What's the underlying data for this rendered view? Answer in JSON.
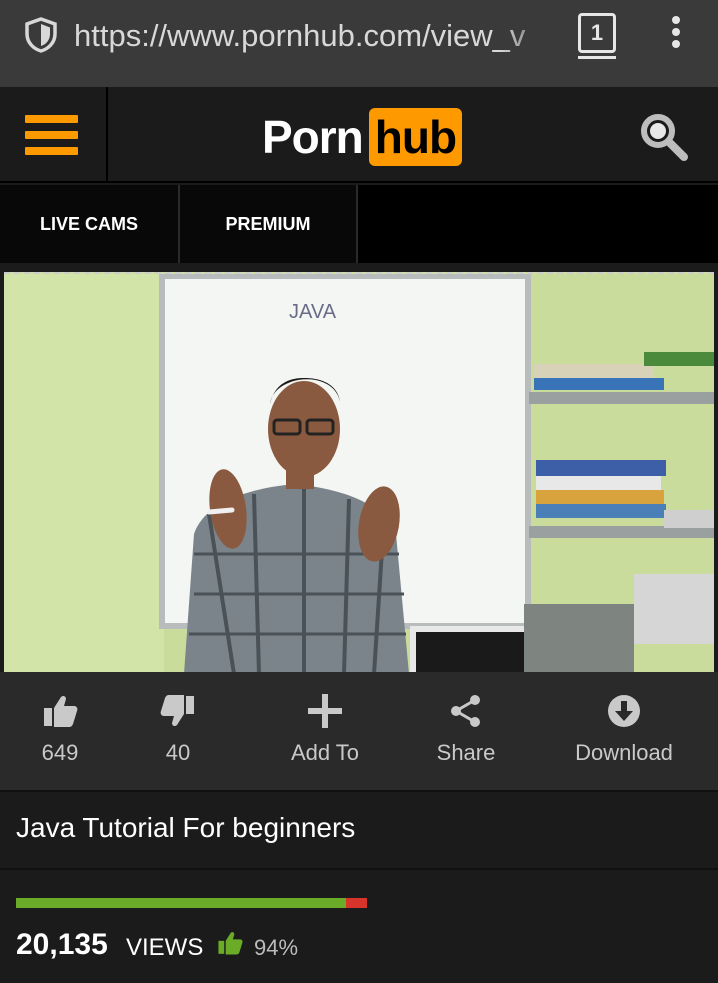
{
  "browser": {
    "url": "https://www.pornhub.com/view_v",
    "tab_count": "1",
    "icons": [
      "shield-icon",
      "tabs-icon",
      "more-vertical-icon"
    ]
  },
  "header": {
    "logo_part1": "Porn",
    "logo_part2": "hub",
    "accent_color": "#ff9900",
    "icons": [
      "hamburger-menu-icon",
      "search-icon"
    ]
  },
  "nav": {
    "items": [
      {
        "label": "LIVE CAMS"
      },
      {
        "label": "PREMIUM"
      }
    ]
  },
  "video": {
    "whiteboard_text": "JAVA"
  },
  "actions": {
    "like_count": "649",
    "dislike_count": "40",
    "add_to_label": "Add To",
    "share_label": "Share",
    "download_label": "Download"
  },
  "video_info": {
    "title": "Java Tutorial For beginners",
    "views_count": "20,135",
    "views_label": "VIEWS",
    "rating_percent": "94%",
    "rating_fraction": 0.94,
    "rating_colors": {
      "positive": "#6aac28",
      "negative": "#d9342b"
    }
  }
}
